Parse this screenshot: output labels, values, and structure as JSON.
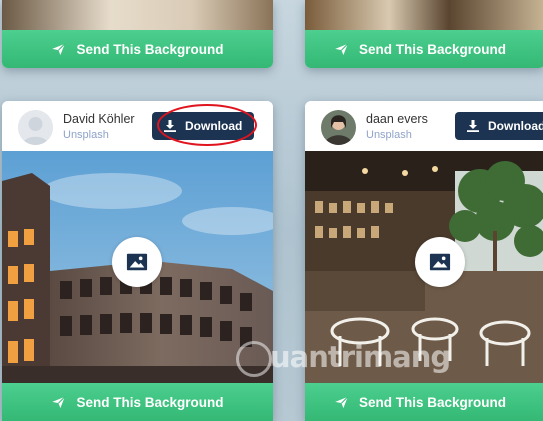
{
  "top_cards": [
    {
      "send_label": "Send This Background"
    },
    {
      "send_label": "Send This Background"
    }
  ],
  "cards": [
    {
      "author": "David Köhler",
      "source": "Unsplash",
      "download_label": "Download",
      "send_label": "Send This Background",
      "image_alt": "Colosseum at dusk"
    },
    {
      "author": "daan evers",
      "source": "Unsplash",
      "download_label": "Download",
      "send_label": "Send This Background",
      "image_alt": "Cafe interior with plants"
    }
  ],
  "watermark": "uantrimang",
  "colors": {
    "send_green": "#3cc281",
    "download_navy": "#1c3452",
    "highlight_red": "#e0141e",
    "source_link": "#8fa3c9"
  }
}
